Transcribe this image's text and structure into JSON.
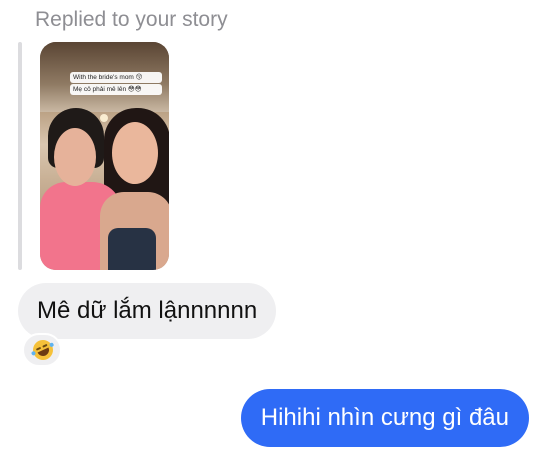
{
  "reply_header": "Replied to your story",
  "story": {
    "sticker_line_1": "With the bride's mom 😚",
    "sticker_line_2": "Mẹ cô phải mê lên 😳😳"
  },
  "messages": {
    "received_text": "Mê dữ lắm lậnnnnnn",
    "received_reaction_icon": "rolling-on-floor-laughing-emoji",
    "sent_text": "Hihihi nhìn cưng gì đâu"
  },
  "colors": {
    "sent_bubble": "#2f6bf6",
    "received_bubble": "#efeff1",
    "meta_text": "#8e8e93"
  }
}
